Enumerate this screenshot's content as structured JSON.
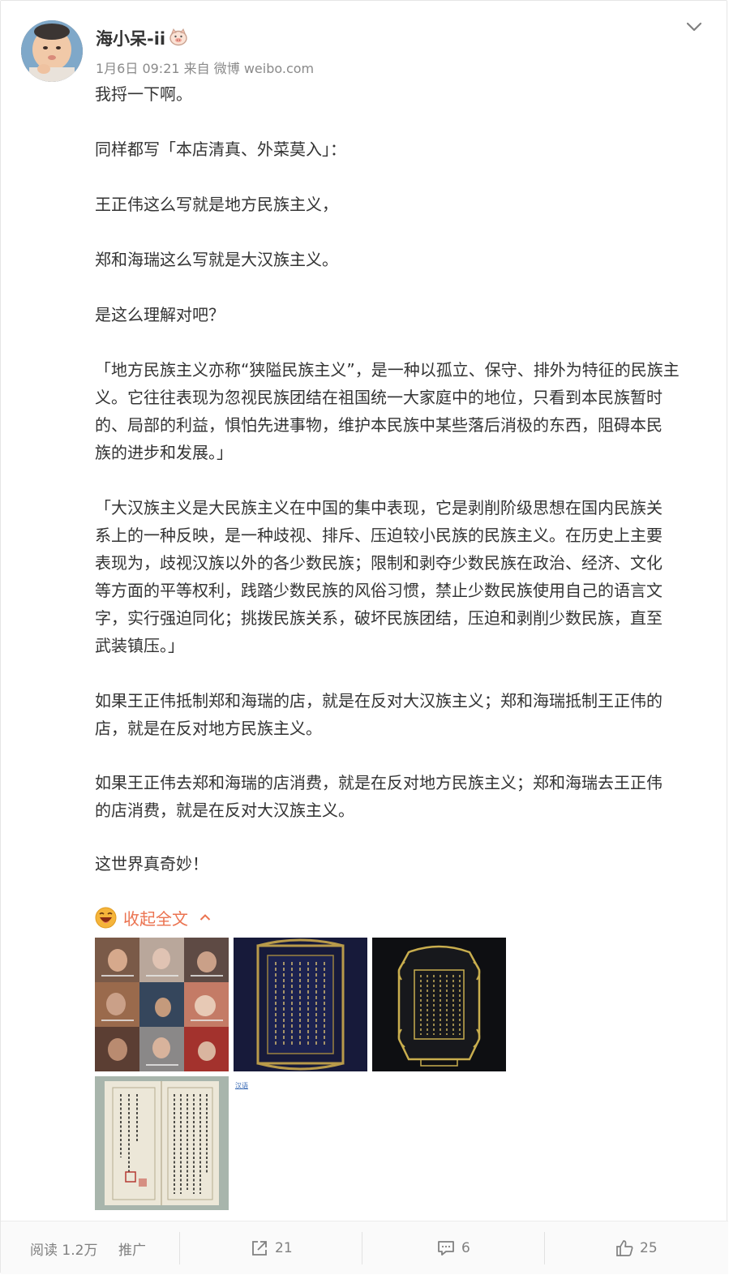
{
  "post": {
    "username": "海小呆-ii",
    "meta": "1月6日 09:21 来自 微博 weibo.com",
    "paragraphs": [
      [
        "我捋一下啊。"
      ],
      [
        "同样都写「本店清真、外菜莫入」："
      ],
      [
        "王正伟这么写就是地方民族主义，"
      ],
      [
        "郑和海瑞这么写就是大汉族主义。"
      ],
      [
        "是这么理解对吧？"
      ],
      [
        "「地方民族主义亦称“狭隘民族主义”，是一种以孤立、保守、排外为特征的民族主",
        "义。它往往表现为忽视民族团结在祖国统一大家庭中的地位，只看到本民族暂时",
        "的、局部的利益，惧怕先进事物，维护本民族中某些落后消极的东西，阻碍本民",
        "族的进步和发展。」"
      ],
      [
        "「大汉族主义是大民族主义在中国的集中表现，它是剥削阶级思想在国内民族关",
        "系上的一种反映，是一种歧视、排斥、压迫较小民族的民族主义。在历史上主要",
        "表现为，歧视汉族以外的各少数民族；限制和剥夺少数民族在政治、经济、文化",
        "等方面的平等权利，践踏少数民族的风俗习惯，禁止少数民族使用自己的语言文",
        "字，实行强迫同化；挑拨民族关系，破坏民族团结，压迫和剥削少数民族，直至",
        "武装镇压。」"
      ],
      [
        "如果王正伟抵制郑和海瑞的店，就是在反对大汉族主义；郑和海瑞抵制王正伟的",
        "店，就是在反对地方民族主义。"
      ],
      [
        "如果王正伟去郑和海瑞的店消费，就是在反对地方民族主义；郑和海瑞去王正伟",
        "的店消费，就是在反对大汉族主义。"
      ],
      [
        "这世界真奇妙！"
      ]
    ],
    "collapse_label": "收起全文",
    "thumb5": {
      "heading": "汉语",
      "lines": [
        "主事臣周钧谨奏：为直言天下第一事，以正君道",
        "万物之主也。惟其为天下臣民万物之主，责任至",
        "有所不得其任。是故事君之道宜无不备，而以其",
        "，而君道斯称矣。昔之务为容悦，阿谀曲从，致",
        "矣。",
        "：“君子危辞士，忧谏忧。”夫世则治矣，以不",
        "：天乃使之反求诸身，知其过失乎！非谏诤",
        "请执有犯无隐之义，臭曰臭，不一蔽成臭，以日"
      ]
    }
  },
  "footer": {
    "reads": "阅读 1.2万",
    "promote": "推广",
    "reposts": "21",
    "comments": "6",
    "likes": "25"
  }
}
